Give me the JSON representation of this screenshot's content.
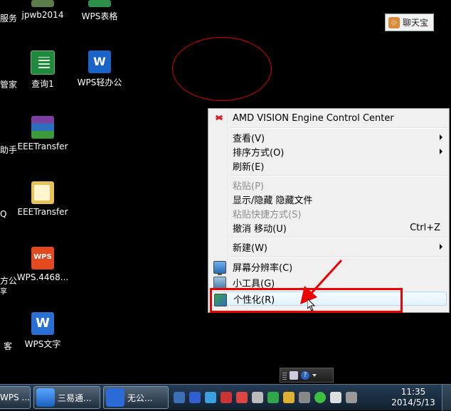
{
  "desktop": {
    "partial_labels": {
      "row1": "服务",
      "row2": "管家",
      "row3": "助手",
      "row4": "Q",
      "row5a": "方公",
      "row5b": "享",
      "row6": "客"
    },
    "icons": [
      {
        "label": "jpwb2014",
        "icon": "app-icon"
      },
      {
        "label": "WPS表格",
        "icon": "wps-spreadsheet-icon"
      },
      {
        "label": "查询1",
        "icon": "excel-icon"
      },
      {
        "label": "WPS轻办公",
        "icon": "wps-light-office-icon"
      },
      {
        "label": "EEETransfer",
        "icon": "winrar-icon"
      },
      {
        "label": "EEETransfer",
        "icon": "folder-icon"
      },
      {
        "label": "WPS.4468...",
        "icon": "wps-icon"
      },
      {
        "label": "WPS文字",
        "icon": "wps-writer-icon"
      }
    ],
    "chat_button": {
      "label": "聊天宝",
      "icon": "chat-icon"
    }
  },
  "context_menu": {
    "items": [
      {
        "label": "AMD VISION Engine Control Center",
        "icon": "amd-icon",
        "enabled": true
      },
      {
        "label": "查看(V)",
        "submenu": true,
        "enabled": true
      },
      {
        "label": "排序方式(O)",
        "submenu": true,
        "enabled": true
      },
      {
        "label": "刷新(E)",
        "enabled": true
      },
      {
        "label": "粘贴(P)",
        "enabled": false
      },
      {
        "label": "显示/隐藏 隐藏文件",
        "enabled": true
      },
      {
        "label": "粘贴快捷方式(S)",
        "enabled": false
      },
      {
        "label": "撤消 移动(U)",
        "shortcut": "Ctrl+Z",
        "enabled": true
      },
      {
        "label": "新建(W)",
        "submenu": true,
        "enabled": true
      },
      {
        "label": "屏幕分辨率(C)",
        "icon": "screen-resolution-icon",
        "enabled": true
      },
      {
        "label": "小工具(G)",
        "icon": "gadgets-icon",
        "enabled": true
      },
      {
        "label": "个性化(R)",
        "icon": "personalize-icon",
        "enabled": true,
        "highlighted": true
      }
    ]
  },
  "annotations": {
    "ellipse_color": "#dd0000",
    "highlight_box_color": "#ee0000",
    "arrow_color": "#ee0000"
  },
  "taskbar": {
    "buttons": [
      {
        "label": "WPS ...",
        "icon": "wps-icon"
      },
      {
        "label": "三易通...",
        "icon": "sanyitong-icon"
      },
      {
        "label": "无公...",
        "icon": "browser-icon"
      }
    ],
    "tray_icons": [
      "antivirus-icon",
      "baidu-icon",
      "network-monitor-icon",
      "ime-icon",
      "chinese-icon",
      "volume-icon",
      "shield-icon",
      "qq-icon",
      "network-icon",
      "add-icon",
      "flag-icon",
      "ime-switch-icon"
    ],
    "clock": {
      "time": "11:35",
      "date": "2014/5/13"
    }
  },
  "language_bar": {
    "icons": [
      "keyboard-icon",
      "help-icon",
      "dropdown-icon"
    ]
  }
}
